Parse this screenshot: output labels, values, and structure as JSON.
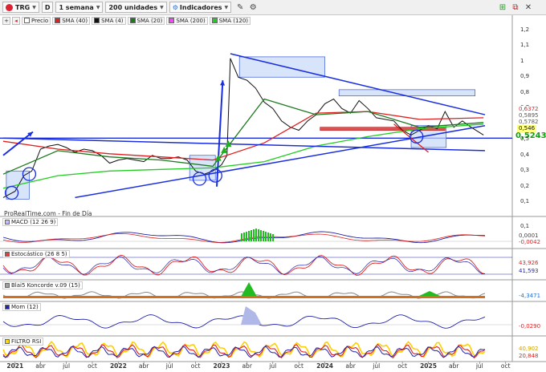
{
  "toolbar": {
    "ticker": "TRG",
    "mode": "D",
    "period": "1 semana",
    "units": "200 unidades",
    "indicators": "Indicadores"
  },
  "legend": [
    {
      "name": "Precio",
      "color": "#ffffff"
    },
    {
      "name": "SMA (40)",
      "color": "#e02020"
    },
    {
      "name": "SMA (4)",
      "color": "#111111"
    },
    {
      "name": "SMA (20)",
      "color": "#1e7a1e"
    },
    {
      "name": "SMA (200)",
      "color": "#ff40ff"
    },
    {
      "name": "SMA (120)",
      "color": "#22cc22"
    }
  ],
  "source_text": "ProRealTime.com - Fin de Día",
  "price_axis": [
    "1,2",
    "1,1",
    "1",
    "0,9",
    "0,8",
    "0,7",
    "0,6",
    "0,5",
    "0,4",
    "0,3",
    "0,2",
    "0,1"
  ],
  "price_tags": [
    {
      "text": "0,6372",
      "color": "#e02020",
      "bg": "#ffffff"
    },
    {
      "text": "0,5895",
      "color": "#555555",
      "bg": "#ffffff"
    },
    {
      "text": "0,5782",
      "color": "#555555",
      "bg": "#ffffff"
    },
    {
      "text": "0,546",
      "color": "#111111",
      "bg": "#ffff80"
    }
  ],
  "last_price": "0,5243",
  "panels": {
    "macd": {
      "label": "MACD (12 26 9)",
      "axis_top": "0,1",
      "tags": [
        "0,0001",
        "-0,0042"
      ]
    },
    "stoch": {
      "label": "Estocástico (26 8 5)",
      "tags": [
        "43,926",
        "41,593"
      ]
    },
    "blai5": {
      "label": "Blai5 Koncorde v.09 (15)",
      "tags": [
        "-4,3471"
      ]
    },
    "mom": {
      "label": "Mom (12)",
      "tags": [
        "-0,0290"
      ]
    },
    "rsi": {
      "label": "FILTRO RSI",
      "tags": [
        "40,902",
        "20,848"
      ]
    }
  },
  "months": [
    {
      "text": "2021",
      "year": true
    },
    {
      "text": "abr",
      "year": false
    },
    {
      "text": "jul",
      "year": false
    },
    {
      "text": "oct",
      "year": false
    },
    {
      "text": "2022",
      "year": true
    },
    {
      "text": "abr",
      "year": false
    },
    {
      "text": "jul",
      "year": false
    },
    {
      "text": "oct",
      "year": false
    },
    {
      "text": "2023",
      "year": true
    },
    {
      "text": "abr",
      "year": false
    },
    {
      "text": "jul",
      "year": false
    },
    {
      "text": "oct",
      "year": false
    },
    {
      "text": "2024",
      "year": true
    },
    {
      "text": "abr",
      "year": false
    },
    {
      "text": "jul",
      "year": false
    },
    {
      "text": "oct",
      "year": false
    },
    {
      "text": "2025",
      "year": true
    },
    {
      "text": "abr",
      "year": false
    },
    {
      "text": "jul",
      "year": false
    },
    {
      "text": "oct",
      "year": false
    }
  ],
  "chart_data": {
    "type": "line",
    "title": "",
    "xlabel": "",
    "ylabel": "",
    "ylim": [
      0.05,
      1.25
    ],
    "x_start": "2020-11-20",
    "x_end": "2025-07-20",
    "grid": false,
    "legend_placement": "top-left",
    "series": [
      {
        "name": "Precio",
        "color": "#111111",
        "x": [
          "2020-11-20",
          "2021-01-01",
          "2021-02-01",
          "2021-03-01",
          "2021-04-01",
          "2021-05-01",
          "2021-06-01",
          "2021-07-01",
          "2021-08-01",
          "2021-09-01",
          "2021-10-01",
          "2021-11-01",
          "2021-12-01",
          "2022-01-01",
          "2022-02-01",
          "2022-03-01",
          "2022-04-01",
          "2022-05-01",
          "2022-06-01",
          "2022-07-01",
          "2022-08-01",
          "2022-09-01",
          "2022-10-01",
          "2022-11-01",
          "2022-12-01",
          "2023-01-01",
          "2023-01-20",
          "2023-02-01",
          "2023-03-01",
          "2023-04-01",
          "2023-05-01",
          "2023-06-01",
          "2023-07-01",
          "2023-08-01",
          "2023-09-01",
          "2023-10-01",
          "2023-11-01",
          "2023-12-01",
          "2024-01-01",
          "2024-02-01",
          "2024-03-01",
          "2024-04-01",
          "2024-05-01",
          "2024-06-01",
          "2024-07-01",
          "2024-08-01",
          "2024-09-01",
          "2024-10-01",
          "2024-11-01",
          "2024-12-01",
          "2025-01-01",
          "2025-02-01",
          "2025-03-01",
          "2025-04-01",
          "2025-05-01",
          "2025-06-01",
          "2025-07-15"
        ],
        "y": [
          0.13,
          0.17,
          0.27,
          0.3,
          0.44,
          0.46,
          0.47,
          0.45,
          0.42,
          0.44,
          0.43,
          0.4,
          0.35,
          0.37,
          0.38,
          0.37,
          0.36,
          0.4,
          0.38,
          0.38,
          0.39,
          0.37,
          0.3,
          0.28,
          0.3,
          0.34,
          0.4,
          1.02,
          0.9,
          0.88,
          0.83,
          0.74,
          0.7,
          0.62,
          0.58,
          0.56,
          0.62,
          0.66,
          0.73,
          0.76,
          0.7,
          0.67,
          0.75,
          0.7,
          0.64,
          0.63,
          0.62,
          0.56,
          0.53,
          0.56,
          0.59,
          0.57,
          0.68,
          0.58,
          0.62,
          0.58,
          0.53
        ]
      },
      {
        "name": "SMA (40)",
        "color": "#e02020",
        "x": [
          "2020-11-20",
          "2021-06-01",
          "2021-12-01",
          "2022-06-01",
          "2022-12-01",
          "2023-06-01",
          "2023-12-01",
          "2024-06-01",
          "2024-12-01",
          "2025-07-15"
        ],
        "y": [
          0.49,
          0.44,
          0.41,
          0.39,
          0.37,
          0.48,
          0.67,
          0.68,
          0.63,
          0.64
        ]
      },
      {
        "name": "SMA (120)",
        "color": "#22cc22",
        "x": [
          "2020-11-20",
          "2021-06-01",
          "2021-12-01",
          "2022-06-01",
          "2022-12-01",
          "2023-06-01",
          "2023-12-01",
          "2024-06-01",
          "2024-12-01",
          "2025-07-15"
        ],
        "y": [
          0.19,
          0.27,
          0.3,
          0.31,
          0.32,
          0.36,
          0.46,
          0.52,
          0.57,
          0.6
        ]
      },
      {
        "name": "SMA (20)",
        "color": "#1e7a1e",
        "x": [
          "2020-11-20",
          "2021-06-01",
          "2021-12-01",
          "2022-06-01",
          "2022-12-01",
          "2023-06-01",
          "2023-12-01",
          "2024-06-01",
          "2024-12-01",
          "2025-07-15"
        ],
        "y": [
          0.28,
          0.43,
          0.39,
          0.37,
          0.33,
          0.76,
          0.66,
          0.68,
          0.58,
          0.61
        ]
      }
    ],
    "annotations": [
      {
        "type": "trendline",
        "color": "#1a2ee0",
        "from": [
          "2023-02-01",
          1.05
        ],
        "to": [
          "2025-07-20",
          0.66
        ]
      },
      {
        "type": "trendline",
        "color": "#1a2ee0",
        "from": [
          "2021-08-01",
          0.13
        ],
        "to": [
          "2025-07-20",
          0.59
        ]
      },
      {
        "type": "trendline",
        "color": "#1a2ee0",
        "from": [
          "2020-11-20",
          0.51
        ],
        "to": [
          "2025-07-20",
          0.43
        ]
      }
    ]
  }
}
